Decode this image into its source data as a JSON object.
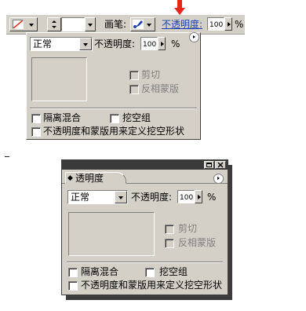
{
  "annotations": {
    "dash": "_"
  },
  "options_bar": {
    "brush_label": "画笔:",
    "opacity_link": "不透明度:",
    "opacity_value": "100",
    "percent": "%"
  },
  "dropdown_panel": {
    "blend_mode": "正常",
    "opacity_label": "不透明度:",
    "opacity_value": "100",
    "percent": "%",
    "clip_label": "剪切",
    "invert_mask_label": "反相蒙版",
    "isolate_blend_label": "隔离混合",
    "knockout_group_label": "挖空组",
    "opacity_mask_label": "不透明度和蒙版用来定义挖空形状"
  },
  "palette": {
    "tab_label": "透明度",
    "blend_mode": "正常",
    "opacity_label": "不透明度:",
    "opacity_value": "100",
    "percent": "%",
    "clip_label": "剪切",
    "invert_mask_label": "反相蒙版",
    "isolate_blend_label": "隔离混合",
    "knockout_group_label": "挖空组",
    "opacity_mask_label": "不透明度和蒙版用来定义挖空形状"
  },
  "colors": {
    "panel_bg": "#d4d0c8",
    "title_bar": "#3a3a3a",
    "link_blue": "#1a3fb0",
    "callout_red": "#e8261c"
  },
  "icons": [
    "red-arrow-callout",
    "fill-none-swatch",
    "brush-icon",
    "panel-menu-icon",
    "minimize-icon",
    "close-icon",
    "tab-grip-icon"
  ]
}
